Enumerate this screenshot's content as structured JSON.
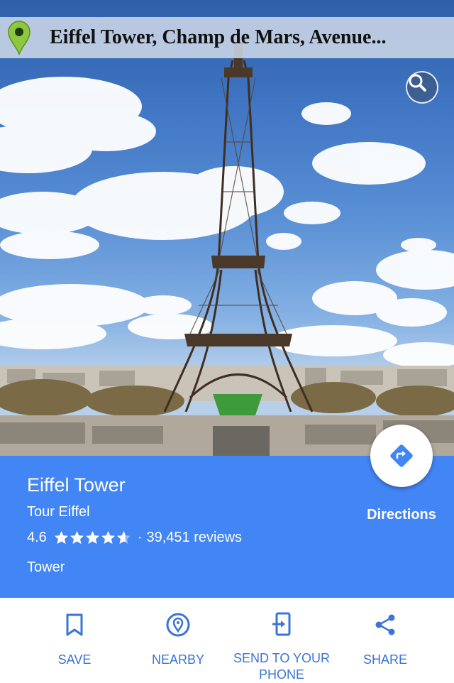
{
  "address_bar": {
    "text": "Eiffel Tower, Champ de Mars, Avenue..."
  },
  "hero": {
    "icons": [
      "map-pin-icon",
      "search-icon"
    ]
  },
  "place": {
    "name": "Eiffel Tower",
    "alt_name": "Tour Eiffel",
    "rating": "4.6",
    "rating_value": 4.6,
    "rating_max": 5,
    "separator": "·",
    "reviews": "39,451 reviews",
    "type": "Tower"
  },
  "directions": {
    "label": "Directions",
    "icon": "directions-icon"
  },
  "actions": [
    {
      "label": "SAVE",
      "icon": "bookmark-icon"
    },
    {
      "label": "NEARBY",
      "icon": "nearby-pin-icon"
    },
    {
      "label": "SEND TO YOUR PHONE",
      "icon": "send-to-phone-icon"
    },
    {
      "label": "SHARE",
      "icon": "share-icon"
    }
  ],
  "colors": {
    "accent": "#4285f4",
    "action_text": "#3a74d6",
    "pin": "#8dc63f"
  }
}
